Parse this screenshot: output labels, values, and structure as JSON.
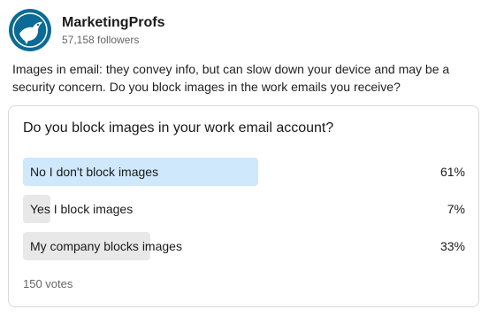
{
  "author": {
    "name": "MarketingProfs",
    "followers": "57,158 followers",
    "avatar_icon": "marketingprofs-bird-logo-icon",
    "brand_color": "#0b6b96"
  },
  "post": {
    "text": "Images in email: they convey info, but can slow down your device and may be a security concern. Do you block images in the work emails you receive?"
  },
  "poll": {
    "question": "Do you block images in your work email account?",
    "options": [
      {
        "label": "No I don't block images",
        "percent": "61%",
        "share": 0.61,
        "selected": true
      },
      {
        "label": "Yes I block images",
        "percent": "7%",
        "share": 0.07,
        "selected": false
      },
      {
        "label": "My company blocks images",
        "percent": "33%",
        "share": 0.33,
        "selected": false
      }
    ],
    "votes": "150 votes",
    "colors": {
      "selected_bar": "#d0e8fb",
      "other_bar": "#e8e8e8"
    }
  }
}
